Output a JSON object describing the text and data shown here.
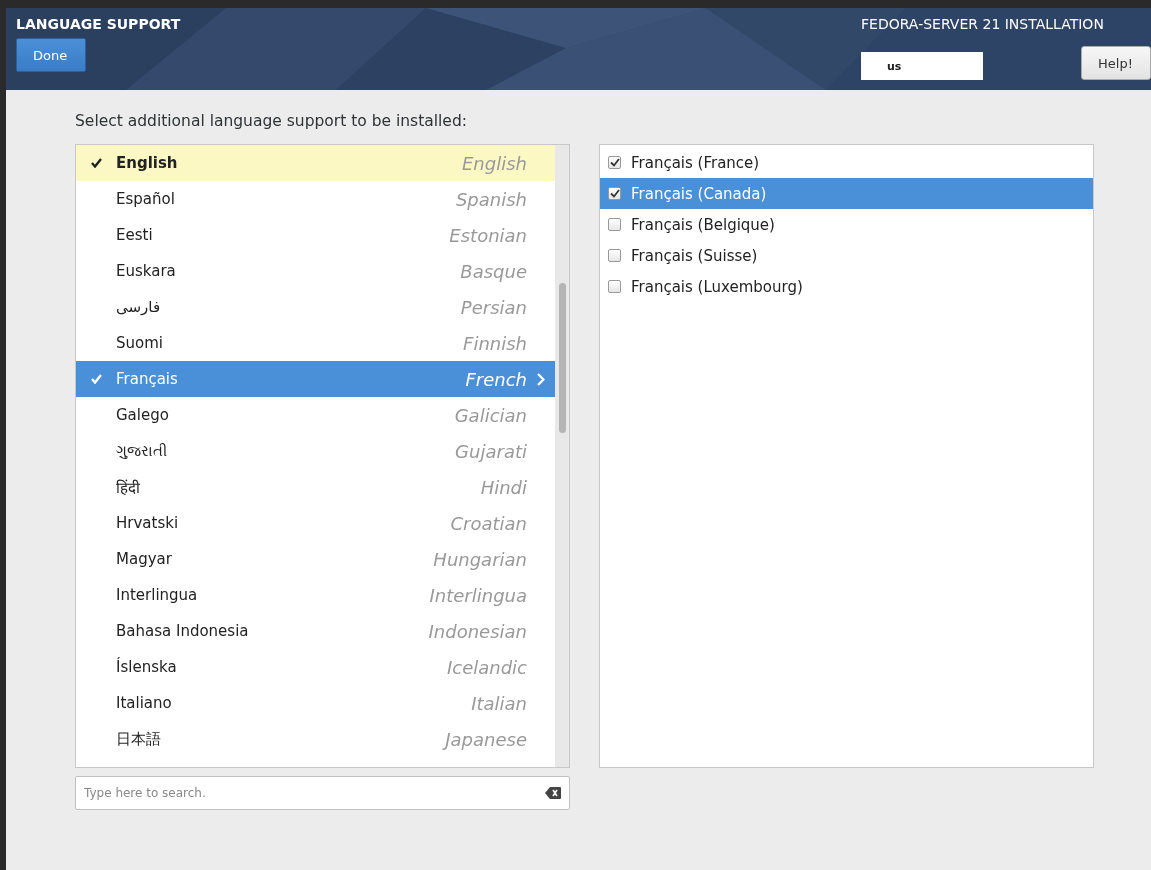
{
  "header": {
    "title": "LANGUAGE SUPPORT",
    "done_button": "Done",
    "product": "FEDORA-SERVER 21 INSTALLATION",
    "keyboard": "us",
    "help_button": "Help!"
  },
  "prompt": "Select additional language support to be installed:",
  "languages": [
    {
      "native": "English",
      "english": "English",
      "checked": true,
      "current": true,
      "selected": false
    },
    {
      "native": "Español",
      "english": "Spanish",
      "checked": false,
      "current": false,
      "selected": false
    },
    {
      "native": "Eesti",
      "english": "Estonian",
      "checked": false,
      "current": false,
      "selected": false
    },
    {
      "native": "Euskara",
      "english": "Basque",
      "checked": false,
      "current": false,
      "selected": false
    },
    {
      "native": "فارسی",
      "english": "Persian",
      "checked": false,
      "current": false,
      "selected": false
    },
    {
      "native": "Suomi",
      "english": "Finnish",
      "checked": false,
      "current": false,
      "selected": false
    },
    {
      "native": "Français",
      "english": "French",
      "checked": true,
      "current": false,
      "selected": true
    },
    {
      "native": "Galego",
      "english": "Galician",
      "checked": false,
      "current": false,
      "selected": false
    },
    {
      "native": "ગુજરાતી",
      "english": "Gujarati",
      "checked": false,
      "current": false,
      "selected": false
    },
    {
      "native": "हिंदी",
      "english": "Hindi",
      "checked": false,
      "current": false,
      "selected": false
    },
    {
      "native": "Hrvatski",
      "english": "Croatian",
      "checked": false,
      "current": false,
      "selected": false
    },
    {
      "native": "Magyar",
      "english": "Hungarian",
      "checked": false,
      "current": false,
      "selected": false
    },
    {
      "native": "Interlingua",
      "english": "Interlingua",
      "checked": false,
      "current": false,
      "selected": false
    },
    {
      "native": "Bahasa Indonesia",
      "english": "Indonesian",
      "checked": false,
      "current": false,
      "selected": false
    },
    {
      "native": "Íslenska",
      "english": "Icelandic",
      "checked": false,
      "current": false,
      "selected": false
    },
    {
      "native": "Italiano",
      "english": "Italian",
      "checked": false,
      "current": false,
      "selected": false
    },
    {
      "native": "日本語",
      "english": "Japanese",
      "checked": false,
      "current": false,
      "selected": false
    }
  ],
  "search": {
    "placeholder": "Type here to search."
  },
  "locales": [
    {
      "label": "Français (France)",
      "checked": true,
      "selected": false
    },
    {
      "label": "Français (Canada)",
      "checked": true,
      "selected": true
    },
    {
      "label": "Français (Belgique)",
      "checked": false,
      "selected": false
    },
    {
      "label": "Français (Suisse)",
      "checked": false,
      "selected": false
    },
    {
      "label": "Français (Luxembourg)",
      "checked": false,
      "selected": false
    }
  ]
}
